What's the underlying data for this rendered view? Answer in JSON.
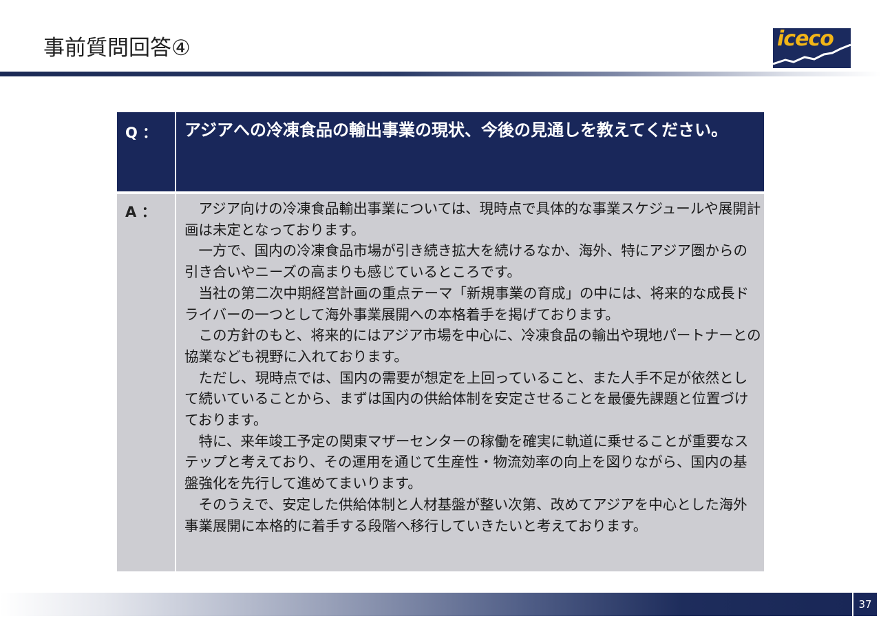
{
  "page": {
    "title": "事前質問回答④",
    "number": "37"
  },
  "logo": {
    "text": "iceco"
  },
  "qa": {
    "question_label": "Q ：",
    "question_text": "アジアへの冷凍食品の輸出事業の現状、今後の見通しを教えてください。",
    "answer_label": "A ：",
    "answer_paragraphs": [
      "　アジア向けの冷凍食品輸出事業については、現時点で具体的な事業スケジュールや展開計画は未定となっております。",
      "　一方で、国内の冷凍食品市場が引き続き拡大を続けるなか、海外、特にアジア圏からの引き合いやニーズの高まりも感じているところです。",
      "　当社の第二次中期経営計画の重点テーマ「新規事業の育成」の中には、将来的な成長ドライバーの一つとして海外事業展開への本格着手を掲げております。",
      "　この方針のもと、将来的にはアジア市場を中心に、冷凍食品の輸出や現地パートナーとの協業なども視野に入れております。",
      "　ただし、現時点では、国内の需要が想定を上回っていること、また人手不足が依然として続いていることから、まずは国内の供給体制を安定させることを最優先課題と位置づけております。",
      "　特に、来年竣工予定の関東マザーセンターの稼働を確実に軌道に乗せることが重要なステップと考えており、その運用を通じて生産性・物流効率の向上を図りながら、国内の基盤強化を先行して進めてまいります。",
      "　そのうえで、安定した供給体制と人材基盤が整い次第、改めてアジアを中心とした海外事業展開に本格的に着手する段階へ移行していきたいと考えております。"
    ]
  }
}
